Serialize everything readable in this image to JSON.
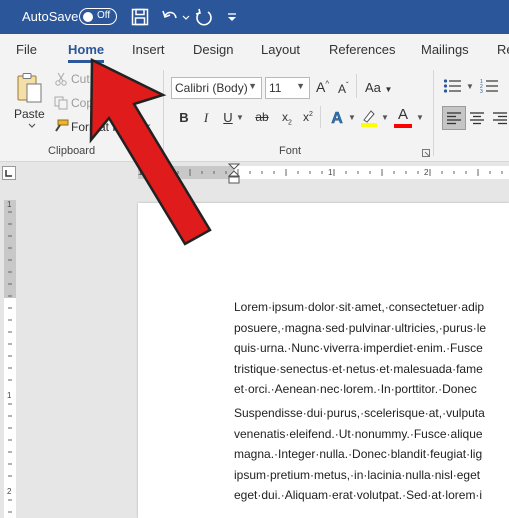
{
  "titlebar": {
    "autosave_label": "AutoSave",
    "autosave_state": "Off"
  },
  "tabs": [
    "File",
    "Home",
    "Insert",
    "Design",
    "Layout",
    "References",
    "Mailings",
    "Re"
  ],
  "clipboard": {
    "paste_label": "Paste",
    "cut_label": "Cut",
    "copy_label": "Copy",
    "format_painter_label": "Format Painter",
    "group_label": "Clipboard"
  },
  "font": {
    "font_name": "Calibri (Body)",
    "font_size": "11",
    "case_label": "Aa",
    "group_label": "Font",
    "bold": "B",
    "italic": "I",
    "underline": "U",
    "strike": "ab",
    "subscript": "x",
    "superscript": "x",
    "grow": "A",
    "shrink": "A",
    "text_effects": "A",
    "font_color": "A"
  },
  "ruler": {
    "h_numbers": [
      "1",
      "1",
      "2"
    ],
    "v_numbers": [
      "1",
      "1",
      "2"
    ]
  },
  "document": {
    "paragraph1": [
      "Lorem·ipsum·dolor·sit·amet,·consectetuer·adip",
      "posuere,·magna·sed·pulvinar·ultricies,·purus·le",
      "quis·urna.·Nunc·viverra·imperdiet·enim.·Fusce",
      "tristique·senectus·et·netus·et·malesuada·fame",
      "et·orci.·Aenean·nec·lorem.·In·porttitor.·Donec"
    ],
    "paragraph2": [
      "Suspendisse·dui·purus,·scelerisque·at,·vulputa",
      "venenatis·eleifend.·Ut·nonummy.·Fusce·alique",
      "magna.·Integer·nulla.·Donec·blandit·feugiat·lig",
      "ipsum·pretium·metus,·in·lacinia·nulla·nisl·eget",
      "eget·dui.·Aliquam·erat·volutpat.·Sed·at·lorem·i"
    ]
  },
  "colors": {
    "title_bar": "#2b579a",
    "arrow": "#e01b1b",
    "highlight": "#ffff00",
    "font_color_bar": "#ff0000"
  },
  "icons": [
    "save-icon",
    "undo-icon",
    "redo-icon",
    "customize-icon",
    "paste-icon",
    "cut-icon",
    "copy-icon",
    "format-painter-icon",
    "bullets-icon",
    "numbering-icon",
    "align-left-icon",
    "align-center-icon",
    "align-right-icon"
  ]
}
